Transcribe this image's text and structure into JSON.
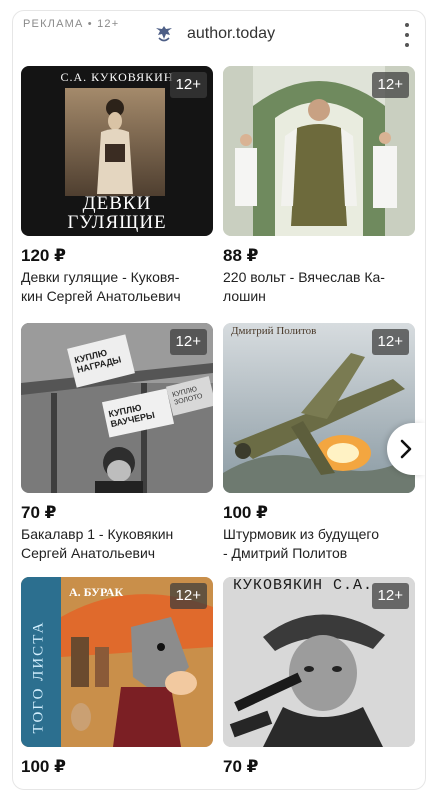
{
  "header": {
    "ad_label": "РЕКЛАМА • 12+",
    "brand_name": "author.today"
  },
  "colors": {
    "badge_bg": "#3c3c3c",
    "text": "#1a1a1a",
    "muted": "#8a8a8a"
  },
  "books": [
    {
      "price": "120 ₽",
      "title_line1": "Девки гулящие - Куковя-",
      "title_line2": "кин Сергей Анатольевич",
      "age": "12+",
      "cover_author": "С.А. КУКОВЯКИН",
      "cover_title_line1": "ДЕВКИ",
      "cover_title_line2": "ГУЛЯЩИЕ"
    },
    {
      "price": "88 ₽",
      "title_line1": "220 вольт - Вячеслав Ка-",
      "title_line2": "лошин",
      "age": "12+"
    },
    {
      "price": "70 ₽",
      "title_line1": "Бакалавр 1 - Куковякин",
      "title_line2": "Сергей Анатольевич",
      "age": "12+",
      "sign_1": "КУПЛЮ НАГРАДЫ",
      "sign_2": "КУПЛЮ ВАУЧЕРЫ",
      "sign_3": "КУПЛЮ ЗОЛОТО"
    },
    {
      "price": "100 ₽",
      "title_line1": "Штурмовик из будущего",
      "title_line2": "- Дмитрий Политов",
      "age": "12+",
      "cover_author": "Дмитрий Политов"
    },
    {
      "price": "100 ₽",
      "title_line1": "",
      "title_line2": "",
      "age": "12+",
      "cover_author": "А. БУРАК",
      "cover_side_text": "ТОГО ЛИСТА"
    },
    {
      "price": "70 ₽",
      "title_line1": "",
      "title_line2": "",
      "age": "12+",
      "cover_author": "КУКОВЯКИН С.А."
    }
  ]
}
